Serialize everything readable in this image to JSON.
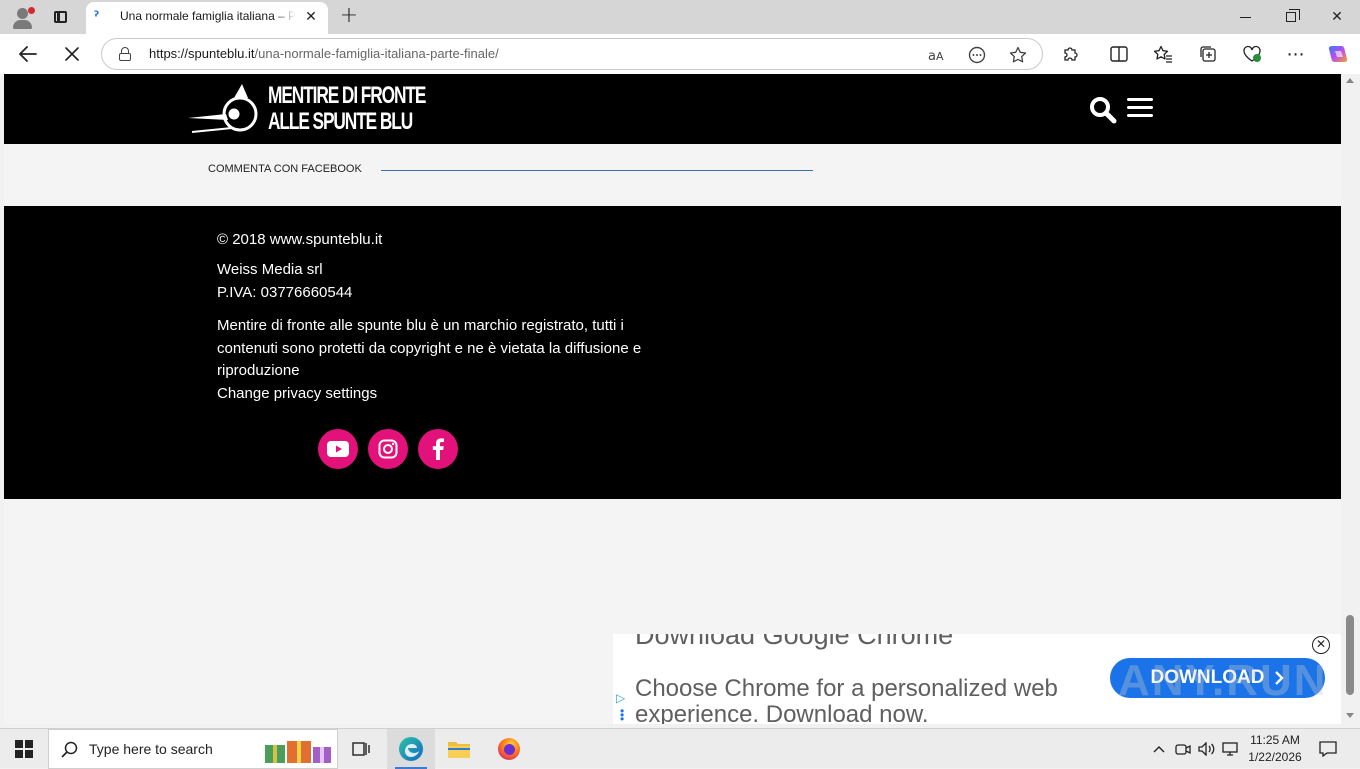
{
  "browser": {
    "tab_title": "Una normale famiglia italiana – Parte finale",
    "url_host": "https://spunteblu.it",
    "url_path": "/una-normale-famiglia-italiana-parte-finale/"
  },
  "site": {
    "logo_line1": "MENTIRE DI FRONTE",
    "logo_line2": "ALLE SPUNTE BLU",
    "comment_label": "COMMENTA CON FACEBOOK"
  },
  "footer": {
    "copyright": "© 2018 www.spunteblu.it",
    "company": "Weiss Media srl",
    "vat": "P.IVA: 03776660544",
    "notice": "Mentire di fronte alle spunte blu è un marchio registrato, tutti i contenuti sono protetti da copyright e ne è vietata la diffusione e riproduzione",
    "privacy_link": "Change privacy settings",
    "social": [
      "youtube-icon",
      "instagram-icon",
      "facebook-icon"
    ],
    "accent_color": "#e3127b"
  },
  "ad": {
    "headline": "Download Google Chrome",
    "body": "Choose Chrome for a personalized web experience. Download now.",
    "cta": "DOWNLOAD",
    "cta_color": "#1a73e8"
  },
  "watermark": "ANY.RUN",
  "taskbar": {
    "search_placeholder": "Type here to search",
    "time": "11:25 AM",
    "date": "1/22/2026"
  }
}
